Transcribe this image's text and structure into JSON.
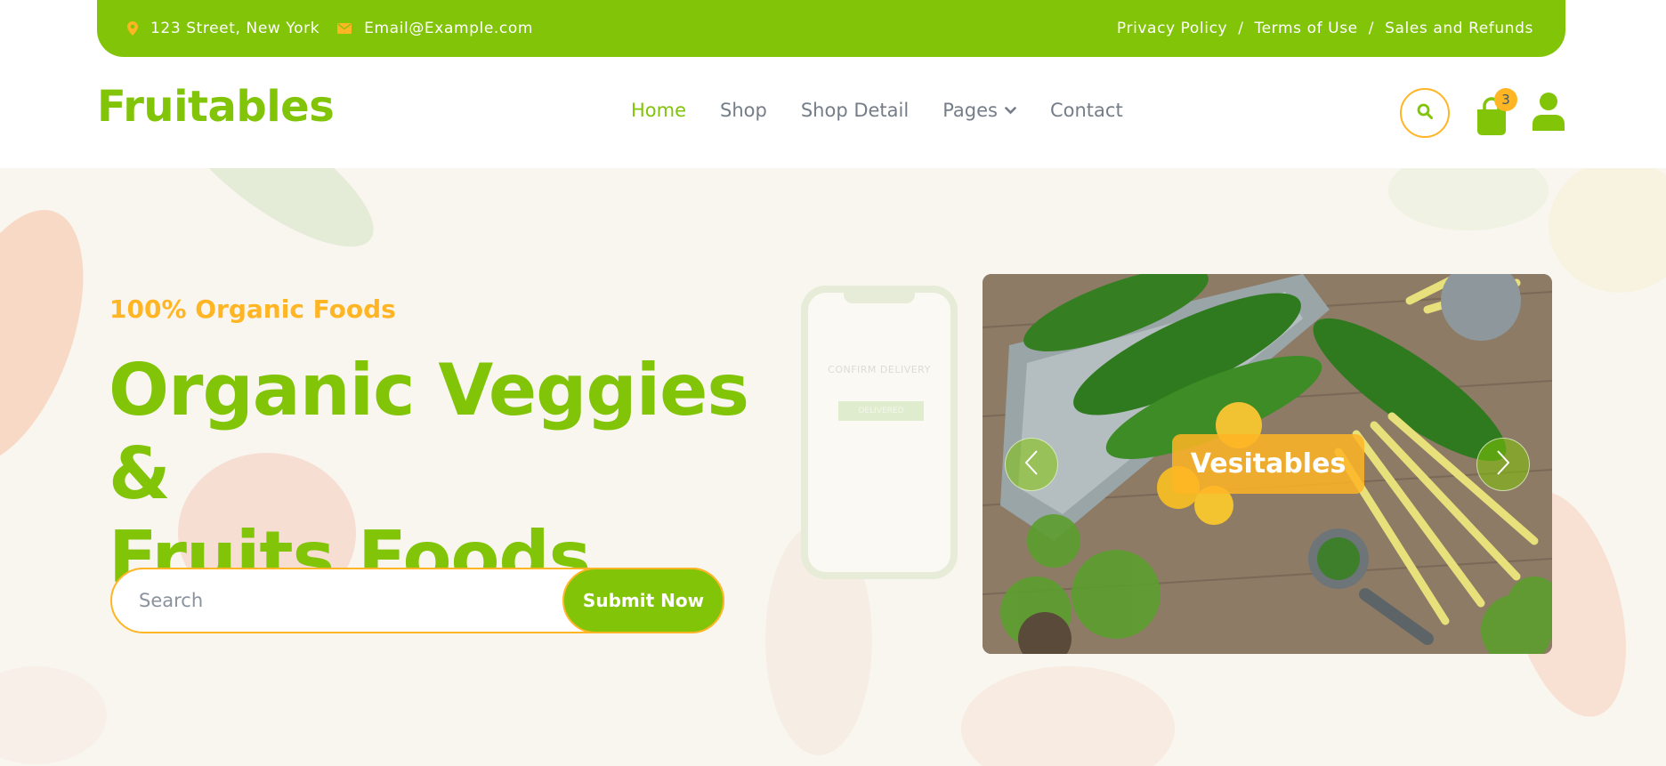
{
  "topbar": {
    "address": "123 Street, New York",
    "email": "Email@Example.com",
    "links": [
      "Privacy Policy",
      "Terms of Use",
      "Sales and Refunds"
    ],
    "separator": "/"
  },
  "navbar": {
    "brand": "Fruitables",
    "links": [
      "Home",
      "Shop",
      "Shop Detail",
      "Pages",
      "Contact"
    ],
    "cart_count": "3"
  },
  "hero": {
    "subheading": "100% Organic Foods",
    "headline_line1": "Organic Veggies &",
    "headline_line2": "Fruits Foods",
    "search_placeholder": "Search",
    "submit_label": "Submit Now",
    "carousel_caption": "Vesitables",
    "phone_text": "CONFIRM DELIVERY",
    "phone_button": "DELIVERED"
  },
  "colors": {
    "primary": "#81c408",
    "accent": "#ffb524",
    "text_muted": "#747d88"
  },
  "icons": [
    "map-marker-icon",
    "envelope-icon",
    "chevron-down-icon",
    "search-icon",
    "shopping-bag-icon",
    "user-icon",
    "chevron-left-icon",
    "chevron-right-icon"
  ]
}
